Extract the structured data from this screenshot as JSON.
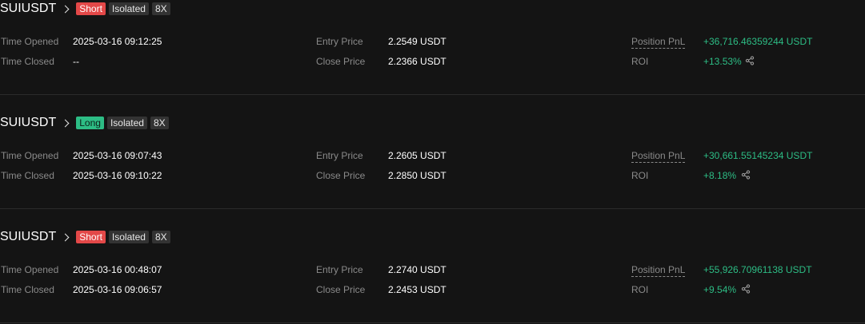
{
  "positions": [
    {
      "symbol": "SUIUSDT",
      "side": "Short",
      "margin": "Isolated",
      "leverage": "8X",
      "labels": {
        "time_opened": "Time Opened",
        "time_closed": "Time Closed",
        "entry_price": "Entry Price",
        "close_price": "Close Price",
        "pnl": "Position PnL",
        "roi": "ROI"
      },
      "time_opened": "2025-03-16 09:12:25",
      "time_closed": "--",
      "entry_price": "2.2549 USDT",
      "close_price": "2.2366 USDT",
      "pnl": "+36,716.46359244 USDT",
      "roi": "+13.53%"
    },
    {
      "symbol": "SUIUSDT",
      "side": "Long",
      "margin": "Isolated",
      "leverage": "8X",
      "labels": {
        "time_opened": "Time Opened",
        "time_closed": "Time Closed",
        "entry_price": "Entry Price",
        "close_price": "Close Price",
        "pnl": "Position PnL",
        "roi": "ROI"
      },
      "time_opened": "2025-03-16 09:07:43",
      "time_closed": "2025-03-16 09:10:22",
      "entry_price": "2.2605 USDT",
      "close_price": "2.2850 USDT",
      "pnl": "+30,661.55145234 USDT",
      "roi": "+8.18%"
    },
    {
      "symbol": "SUIUSDT",
      "side": "Short",
      "margin": "Isolated",
      "leverage": "8X",
      "labels": {
        "time_opened": "Time Opened",
        "time_closed": "Time Closed",
        "entry_price": "Entry Price",
        "close_price": "Close Price",
        "pnl": "Position PnL",
        "roi": "ROI"
      },
      "time_opened": "2025-03-16 00:48:07",
      "time_closed": "2025-03-16 09:06:57",
      "entry_price": "2.2740 USDT",
      "close_price": "2.2453 USDT",
      "pnl": "+55,926.70961138 USDT",
      "roi": "+9.54%"
    }
  ],
  "colors": {
    "background": "#141414",
    "short": "#e34848",
    "long": "#2dbd85",
    "profit": "#2dbd85",
    "label": "#8a8a8a"
  },
  "icons": {
    "chevron": "chevron-right-icon",
    "share": "share-icon"
  }
}
